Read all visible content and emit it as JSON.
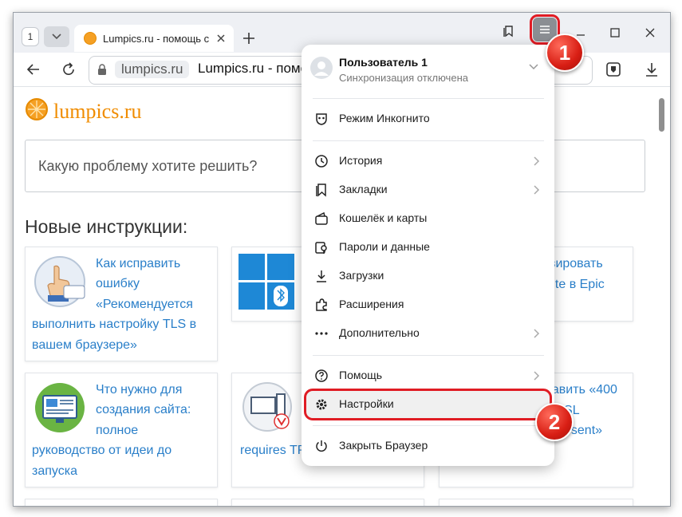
{
  "tabs": {
    "count": "1",
    "active_title": "Lumpics.ru - помощь с"
  },
  "address_bar": {
    "domain": "lumpics.ru",
    "page_title": "Lumpics.ru - помо"
  },
  "page": {
    "logo": "lumpics.ru",
    "search_placeholder": "Какую проблему хотите решить?",
    "section_title": "Новые инструкции:",
    "cards": [
      {
        "lines": [
          "Как исправить",
          "ошибку",
          "«Рекомендуется",
          "выполнить настройку TLS в",
          "вашем браузере»"
        ]
      },
      {
        "lines": [
          "ивировать",
          "tnite в Epic"
        ]
      },
      {
        "lines": [
          "Что нужно для",
          "создания сайта:",
          "полное",
          "руководство от идеи до",
          "запуска"
        ]
      },
      {
        "lines": [
          "requires TP"
        ]
      },
      {
        "lines": [
          "равить «400",
          "d SSL",
          "was sent»"
        ]
      }
    ]
  },
  "menu": {
    "profile": {
      "name": "Пользователь 1",
      "status": "Синхронизация отключена"
    },
    "items": [
      {
        "label": "Режим Инкогнито",
        "icon": "incognito-icon"
      },
      {
        "label": "История",
        "icon": "history-icon"
      },
      {
        "label": "Закладки",
        "icon": "bookmarks-icon"
      },
      {
        "label": "Кошелёк и карты",
        "icon": "wallet-icon"
      },
      {
        "label": "Пароли и данные",
        "icon": "passwords-icon"
      },
      {
        "label": "Загрузки",
        "icon": "downloads-icon"
      },
      {
        "label": "Расширения",
        "icon": "extensions-icon"
      },
      {
        "label": "Дополнительно",
        "icon": "more-icon"
      },
      {
        "label": "Помощь",
        "icon": "help-icon"
      },
      {
        "label": "Настройки",
        "icon": "gear-icon"
      },
      {
        "label": "Закрыть Браузер",
        "icon": "power-icon"
      }
    ]
  },
  "callouts": [
    "1",
    "2"
  ],
  "colors": {
    "accent_red": "#e01c24",
    "link_blue": "#2a7fc9",
    "logo_orange": "#f08c00"
  }
}
